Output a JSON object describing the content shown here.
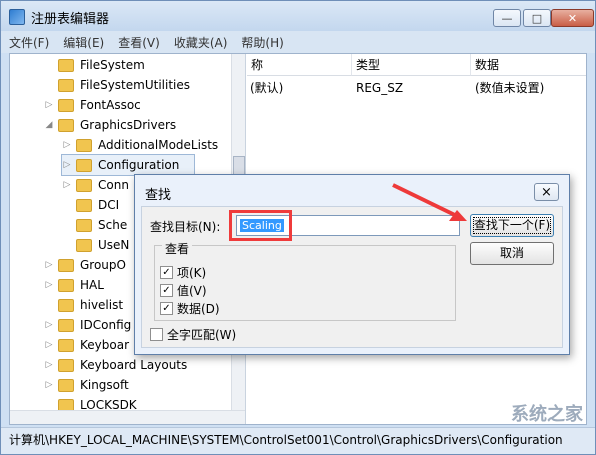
{
  "window": {
    "title": "注册表编辑器",
    "controls": {
      "minimize": "—",
      "maximize": "□",
      "close": "✕"
    }
  },
  "menu": [
    "文件(F)",
    "编辑(E)",
    "查看(V)",
    "收藏夹(A)",
    "帮助(H)"
  ],
  "tree": {
    "items": [
      {
        "label": "FileSystem",
        "expandable": false
      },
      {
        "label": "FileSystemUtilities",
        "expandable": false
      },
      {
        "label": "FontAssoc",
        "expandable": true
      },
      {
        "label": "GraphicsDrivers",
        "expandable": true,
        "expanded": true
      },
      {
        "label": "AdditionalModeLists",
        "expandable": true
      },
      {
        "label": "Configuration",
        "expandable": true,
        "selected": true
      },
      {
        "label": "Conn",
        "expandable": true
      },
      {
        "label": "DCI",
        "expandable": false
      },
      {
        "label": "Sche",
        "expandable": false
      },
      {
        "label": "UseN",
        "expandable": false
      },
      {
        "label": "GroupO",
        "expandable": true
      },
      {
        "label": "HAL",
        "expandable": true
      },
      {
        "label": "hivelist",
        "expandable": false
      },
      {
        "label": "IDConfig",
        "expandable": true
      },
      {
        "label": "Keyboar",
        "expandable": true
      },
      {
        "label": "Keyboard Layouts",
        "expandable": true
      },
      {
        "label": "Kingsoft",
        "expandable": true
      },
      {
        "label": "LOCKSDK",
        "expandable": false
      }
    ]
  },
  "list": {
    "columns": [
      "称",
      "类型",
      "数据"
    ],
    "rows": [
      {
        "name": "(默认)",
        "type": "REG_SZ",
        "data": "(数值未设置)"
      }
    ]
  },
  "dialog": {
    "title": "查找",
    "search_label": "查找目标(N):",
    "search_value": "Scaling",
    "find_next": "查找下一个(F)",
    "cancel": "取消",
    "look_at": "查看",
    "options": [
      {
        "label": "项(K)",
        "checked": true
      },
      {
        "label": "值(V)",
        "checked": true
      },
      {
        "label": "数据(D)",
        "checked": true
      }
    ],
    "match_whole": {
      "label": "全字匹配(W)",
      "checked": false
    }
  },
  "statusbar": "计算机\\HKEY_LOCAL_MACHINE\\SYSTEM\\ControlSet001\\Control\\GraphicsDrivers\\Configuration",
  "watermark": "系统之家",
  "icons": {
    "app": "registry-editor-icon",
    "folder": "folder-icon",
    "expand": "expand-arrow-icon",
    "check": "checkmark-icon"
  }
}
